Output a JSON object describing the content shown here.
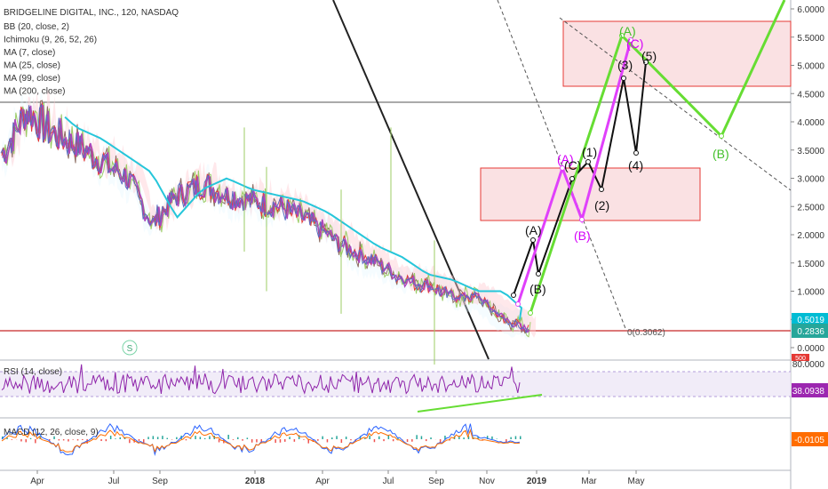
{
  "header": {
    "symbol_title": "BRIDGELINE DIGITAL, INC., 120, NASDAQ",
    "indicators": [
      "BB (20, close, 2)",
      "Ichimoku (9, 26, 52, 26)",
      "MA (7, close)",
      "MA (25, close)",
      "MA (99, close)",
      "MA (200, close)"
    ]
  },
  "price_axis": {
    "ticks": [
      "6.0000",
      "5.5000",
      "5.0000",
      "4.5000",
      "4.0000",
      "3.5000",
      "3.0000",
      "2.5000",
      "2.0000",
      "1.5000",
      "1.0000",
      "0.5000",
      "0.0000"
    ],
    "last_price": "0.2836",
    "ma_price": "0.5019",
    "last_price_color": "#26a69a",
    "ma_price_color": "#00bcd4",
    "volume_badge": "500",
    "volume_badge_color": "#e53935"
  },
  "rsi_panel": {
    "label": "RSI (14, close)",
    "axis_tick": "80.0000",
    "value": "38.0938",
    "value_color": "#9c27b0"
  },
  "macd_panel": {
    "label": "MACD (12, 26, close, 9)",
    "value": "-0.0105",
    "value_color": "#ff6d00"
  },
  "time_axis": [
    "Apr",
    "Jul",
    "Sep",
    "2018",
    "Apr",
    "Jul",
    "Sep",
    "Nov",
    "2019",
    "Mar",
    "May"
  ],
  "wave_labels": {
    "black": [
      "(A)",
      "(B)",
      "(1)",
      "(2)",
      "(3)",
      "(4)",
      "(5)"
    ],
    "magenta": [
      "(A)",
      "(B)",
      "(C)",
      "(C)"
    ],
    "green": [
      "(A)",
      "(B)"
    ]
  },
  "fib_label": "0(0.3062)",
  "marker_s": "S",
  "chart_data": {
    "type": "line",
    "title": "BRIDGELINE DIGITAL, INC., 120, NASDAQ",
    "xlabel": "",
    "ylabel": "",
    "ylim": [
      0,
      6
    ],
    "grid": false,
    "price_series": {
      "name": "",
      "x": [
        "2017-03",
        "2017-04",
        "2017-05",
        "2017-06",
        "2017-07",
        "2017-08",
        "2017-09",
        "2017-10",
        "2017-11",
        "2017-12",
        "2018-01",
        "2018-02",
        "2018-03",
        "2018-04",
        "2018-05",
        "2018-06",
        "2018-07",
        "2018-08",
        "2018-09",
        "2018-10",
        "2018-11",
        "2018-12"
      ],
      "values": [
        3.4,
        4.2,
        3.8,
        3.6,
        3.3,
        3.0,
        2.2,
        2.7,
        2.9,
        2.7,
        2.6,
        2.5,
        2.3,
        2.0,
        1.7,
        1.5,
        1.2,
        1.1,
        0.9,
        0.9,
        0.5,
        0.3
      ]
    },
    "horizontal_levels": [
      4.35,
      0.3062
    ],
    "rsi_last": 38.0938,
    "macd_last": -0.0105
  }
}
